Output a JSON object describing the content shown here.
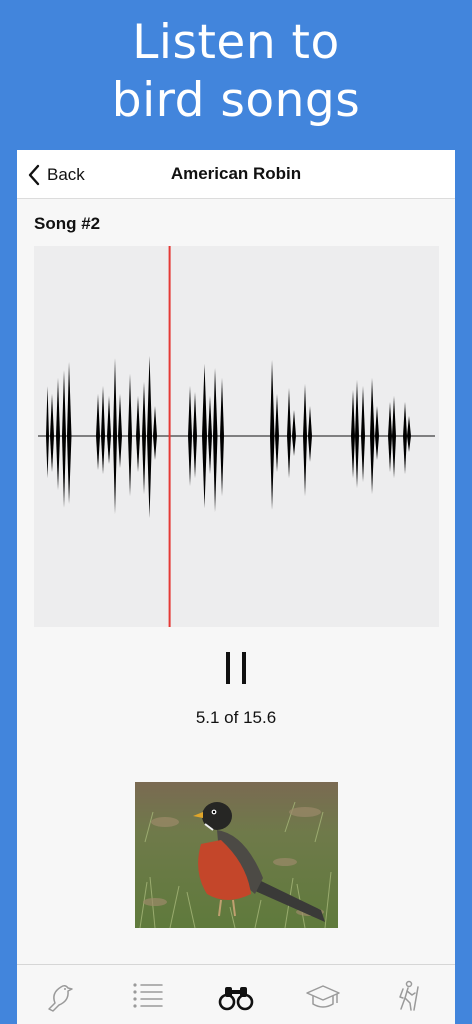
{
  "promo": {
    "headline_line1": "Listen to",
    "headline_line2": "bird songs"
  },
  "navbar": {
    "back_label": "Back",
    "title": "American Robin"
  },
  "player": {
    "song_label": "Song #2",
    "position_seconds": 5.1,
    "duration_seconds": 15.6,
    "time_readout": "5.1 of 15.6",
    "state": "playing",
    "playhead_color": "#e53935"
  },
  "tabs": [
    {
      "icon": "bird-icon",
      "selected": false
    },
    {
      "icon": "list-icon",
      "selected": false
    },
    {
      "icon": "binoculars-icon",
      "selected": true
    },
    {
      "icon": "graduation-cap-icon",
      "selected": false
    },
    {
      "icon": "hiker-icon",
      "selected": false
    }
  ],
  "colors": {
    "background": "#4285dc",
    "selected_tab": "#111111",
    "unselected_tab": "#9a9a9a"
  }
}
